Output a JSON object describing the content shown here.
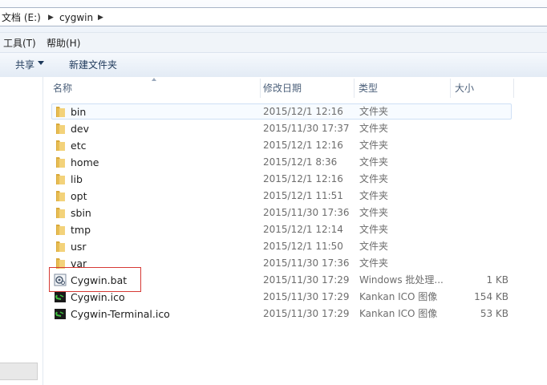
{
  "address": {
    "crumbs": [
      "文档 (E:)",
      "cygwin"
    ]
  },
  "menu": {
    "tools": "工具(T)",
    "help": "帮助(H)"
  },
  "toolbar": {
    "share": "共享",
    "new_folder": "新建文件夹"
  },
  "columns": {
    "name": "名称",
    "date": "修改日期",
    "type": "类型",
    "size": "大小"
  },
  "files": [
    {
      "name": "bin",
      "date": "2015/12/1 12:16",
      "type": "文件夹",
      "size": "",
      "icon": "folder-icon"
    },
    {
      "name": "dev",
      "date": "2015/11/30 17:37",
      "type": "文件夹",
      "size": "",
      "icon": "folder-icon"
    },
    {
      "name": "etc",
      "date": "2015/12/1 12:16",
      "type": "文件夹",
      "size": "",
      "icon": "folder-icon"
    },
    {
      "name": "home",
      "date": "2015/12/1 8:36",
      "type": "文件夹",
      "size": "",
      "icon": "folder-icon"
    },
    {
      "name": "lib",
      "date": "2015/12/1 12:16",
      "type": "文件夹",
      "size": "",
      "icon": "folder-icon"
    },
    {
      "name": "opt",
      "date": "2015/12/1 11:51",
      "type": "文件夹",
      "size": "",
      "icon": "folder-icon"
    },
    {
      "name": "sbin",
      "date": "2015/11/30 17:36",
      "type": "文件夹",
      "size": "",
      "icon": "folder-icon"
    },
    {
      "name": "tmp",
      "date": "2015/12/1 12:14",
      "type": "文件夹",
      "size": "",
      "icon": "folder-icon"
    },
    {
      "name": "usr",
      "date": "2015/12/1 11:50",
      "type": "文件夹",
      "size": "",
      "icon": "folder-icon"
    },
    {
      "name": "var",
      "date": "2015/11/30 17:36",
      "type": "文件夹",
      "size": "",
      "icon": "folder-icon"
    },
    {
      "name": "Cygwin.bat",
      "date": "2015/11/30 17:29",
      "type": "Windows 批处理...",
      "size": "1 KB",
      "icon": "batch-file-icon"
    },
    {
      "name": "Cygwin.ico",
      "date": "2015/11/30 17:29",
      "type": "Kankan ICO 图像",
      "size": "154 KB",
      "icon": "cygwin-icon"
    },
    {
      "name": "Cygwin-Terminal.ico",
      "date": "2015/11/30 17:29",
      "type": "Kankan ICO 图像",
      "size": "53 KB",
      "icon": "cygwin-icon"
    }
  ],
  "colors": {
    "selection_border": "#cfe0f5",
    "highlight_box": "#d63a35",
    "folder": "#e8c25a"
  }
}
